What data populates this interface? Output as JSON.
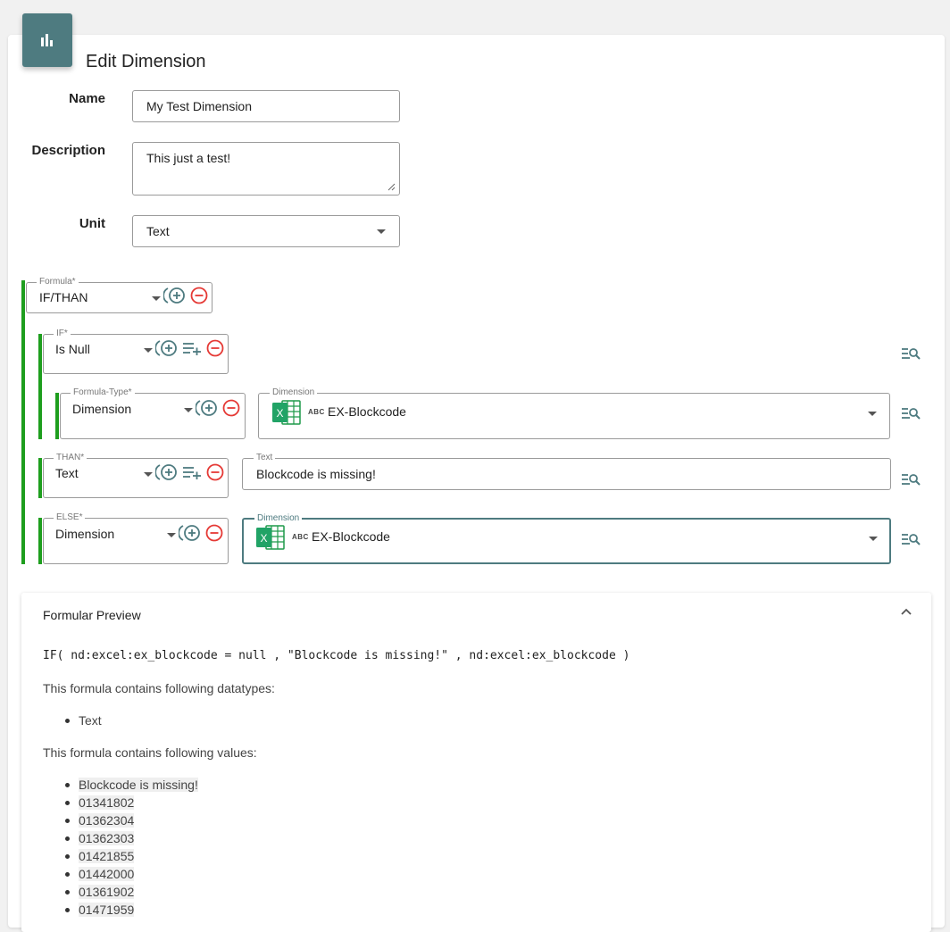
{
  "page": {
    "title": "Edit Dimension"
  },
  "form": {
    "name_label": "Name",
    "name_value": "My Test Dimension",
    "description_label": "Description",
    "description_value": "This just a test!",
    "unit_label": "Unit",
    "unit_value": "Text"
  },
  "formula": {
    "root": {
      "legend": "Formula*",
      "value": "IF/THAN"
    },
    "if": {
      "legend": "IF*",
      "value": "Is Null"
    },
    "formula_type": {
      "legend": "Formula-Type*",
      "value": "Dimension"
    },
    "if_dimension": {
      "legend": "Dimension",
      "badge": "ABC",
      "value": "EX-Blockcode"
    },
    "than": {
      "legend": "THAN*",
      "value": "Text"
    },
    "than_text": {
      "legend": "Text",
      "value": "Blockcode is missing!"
    },
    "else": {
      "legend": "ELSE*",
      "value": "Dimension"
    },
    "else_dimension": {
      "legend": "Dimension",
      "badge": "ABC",
      "value": "EX-Blockcode"
    }
  },
  "preview": {
    "title": "Formular Preview",
    "code": "IF( nd:excel:ex_blockcode = null , \"Blockcode is missing!\" , nd:excel:ex_blockcode )",
    "datatypes_heading": "This formula contains following datatypes:",
    "datatypes": [
      "Text"
    ],
    "values_heading": "This formula contains following values:",
    "values": [
      "Blockcode is missing!",
      "01341802",
      "01362304",
      "01362303",
      "01421855",
      "01442000",
      "01361902",
      "01471959"
    ]
  },
  "colors": {
    "accent": "#4e7b80",
    "green_bar": "#1e9e1e",
    "remove": "#e53935",
    "excel": "#1f9a4a"
  }
}
